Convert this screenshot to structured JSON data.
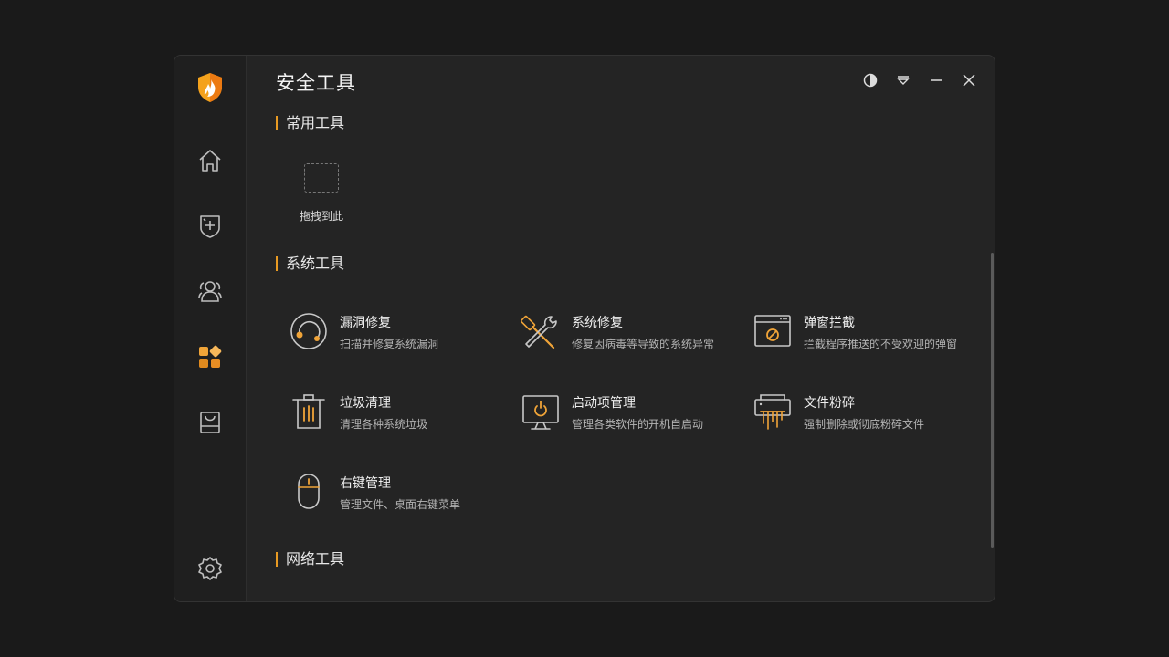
{
  "header": {
    "title": "安全工具"
  },
  "window_controls": [
    {
      "name": "theme-icon"
    },
    {
      "name": "menu-icon"
    },
    {
      "name": "minimize-icon"
    },
    {
      "name": "close-icon"
    }
  ],
  "sidebar": {
    "items": [
      {
        "icon": "home-icon",
        "active": false
      },
      {
        "icon": "shield-plus-icon",
        "active": false
      },
      {
        "icon": "users-icon",
        "active": false
      },
      {
        "icon": "apps-icon",
        "active": true
      },
      {
        "icon": "tray-icon",
        "active": false
      },
      {
        "icon": "gear-icon",
        "active": false
      }
    ]
  },
  "sections": {
    "common": {
      "title": "常用工具",
      "drop_label": "拖拽到此"
    },
    "system": {
      "title": "系统工具",
      "tools": [
        {
          "name": "漏洞修复",
          "desc": "扫描并修复系统漏洞",
          "icon": "vulnerability-icon"
        },
        {
          "name": "系统修复",
          "desc": "修复因病毒等导致的系统异常",
          "icon": "repair-tools-icon"
        },
        {
          "name": "弹窗拦截",
          "desc": "拦截程序推送的不受欢迎的弹窗",
          "icon": "popup-block-icon"
        },
        {
          "name": "垃圾清理",
          "desc": "清理各种系统垃圾",
          "icon": "trash-icon"
        },
        {
          "name": "启动项管理",
          "desc": "管理各类软件的开机自启动",
          "icon": "startup-icon"
        },
        {
          "name": "文件粉碎",
          "desc": "强制删除或彻底粉碎文件",
          "icon": "shredder-icon"
        },
        {
          "name": "右键管理",
          "desc": "管理文件、桌面右键菜单",
          "icon": "mouse-icon"
        }
      ]
    },
    "network": {
      "title": "网络工具"
    }
  },
  "colors": {
    "accent": "#e89a22",
    "background": "#242424",
    "sidebar": "#1f1f1f"
  }
}
